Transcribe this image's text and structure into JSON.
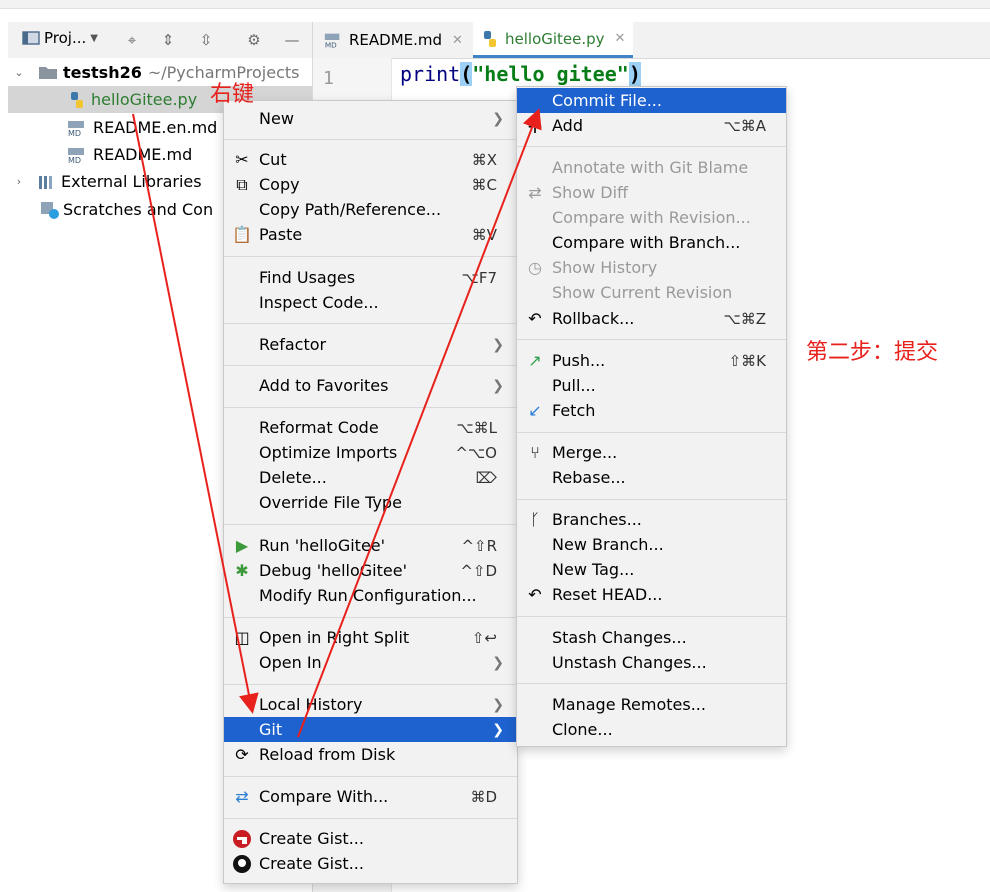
{
  "project_panel": {
    "title": "Proj..."
  },
  "tree": {
    "items": [
      {
        "label": "testsh26",
        "path": "~/PycharmProjects"
      },
      {
        "label": "helloGitee.py"
      },
      {
        "label": "README.en.md"
      },
      {
        "label": "README.md"
      },
      {
        "label": "External Libraries"
      },
      {
        "label": "Scratches and Con"
      }
    ]
  },
  "editor": {
    "tabs": [
      {
        "label": "README.md"
      },
      {
        "label": "helloGitee.py"
      }
    ],
    "line_number": "1",
    "code": {
      "kw": "print",
      "open": "(",
      "str": "\"hello gitee\"",
      "close": ")"
    }
  },
  "context_menu": {
    "items": [
      {
        "label": "New"
      },
      {
        "label": "Cut",
        "shortcut": "⌘X"
      },
      {
        "label": "Copy",
        "shortcut": "⌘C"
      },
      {
        "label": "Copy Path/Reference..."
      },
      {
        "label": "Paste",
        "shortcut": "⌘V"
      },
      {
        "label": "Find Usages",
        "shortcut": "⌥F7"
      },
      {
        "label": "Inspect Code..."
      },
      {
        "label": "Refactor"
      },
      {
        "label": "Add to Favorites"
      },
      {
        "label": "Reformat Code",
        "shortcut": "⌥⌘L"
      },
      {
        "label": "Optimize Imports",
        "shortcut": "^⌥O"
      },
      {
        "label": "Delete...",
        "shortcut": "⌦"
      },
      {
        "label": "Override File Type"
      },
      {
        "label": "Run 'helloGitee'",
        "shortcut": "^⇧R"
      },
      {
        "label": "Debug 'helloGitee'",
        "shortcut": "^⇧D"
      },
      {
        "label": "Modify Run Configuration..."
      },
      {
        "label": "Open in Right Split",
        "shortcut": "⇧↩"
      },
      {
        "label": "Open In"
      },
      {
        "label": "Local History"
      },
      {
        "label": "Git"
      },
      {
        "label": "Reload from Disk"
      },
      {
        "label": "Compare With...",
        "shortcut": "⌘D"
      },
      {
        "label": "Create Gist..."
      },
      {
        "label": "Create Gist..."
      }
    ]
  },
  "git_menu": {
    "items": [
      {
        "label": "Commit File..."
      },
      {
        "label": "Add",
        "shortcut": "⌥⌘A"
      },
      {
        "label": "Annotate with Git Blame"
      },
      {
        "label": "Show Diff"
      },
      {
        "label": "Compare with Revision..."
      },
      {
        "label": "Compare with Branch..."
      },
      {
        "label": "Show History"
      },
      {
        "label": "Show Current Revision"
      },
      {
        "label": "Rollback...",
        "shortcut": "⌥⌘Z"
      },
      {
        "label": "Push...",
        "shortcut": "⇧⌘K"
      },
      {
        "label": "Pull..."
      },
      {
        "label": "Fetch"
      },
      {
        "label": "Merge..."
      },
      {
        "label": "Rebase..."
      },
      {
        "label": "Branches..."
      },
      {
        "label": "New Branch..."
      },
      {
        "label": "New Tag..."
      },
      {
        "label": "Reset HEAD..."
      },
      {
        "label": "Stash Changes..."
      },
      {
        "label": "Unstash Changes..."
      },
      {
        "label": "Manage Remotes..."
      },
      {
        "label": "Clone..."
      }
    ]
  },
  "annotations": {
    "right_click": "右键",
    "step_two": "第二步：提交"
  },
  "colors": {
    "highlight": "#1e62d0",
    "annotation": "#e8211c",
    "string": "#067d17",
    "keyword": "#000080"
  }
}
